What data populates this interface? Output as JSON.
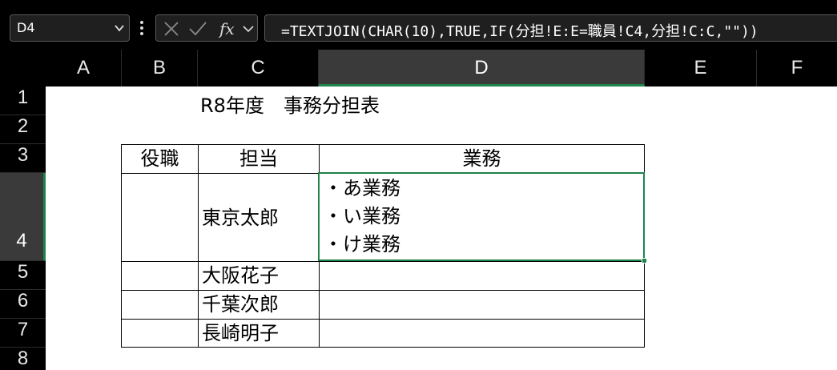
{
  "namebox": {
    "value": "D4"
  },
  "formula_bar": {
    "formula": "=TEXTJOIN(CHAR(10),TRUE,IF(分担!E:E=職員!C4,分担!C:C,\"\"))"
  },
  "columns": [
    {
      "id": "A",
      "label": "A"
    },
    {
      "id": "B",
      "label": "B"
    },
    {
      "id": "C",
      "label": "C"
    },
    {
      "id": "D",
      "label": "D"
    },
    {
      "id": "E",
      "label": "E"
    },
    {
      "id": "F",
      "label": "F"
    }
  ],
  "rows": [
    "1",
    "2",
    "3",
    "4",
    "5",
    "6",
    "7",
    "8"
  ],
  "sheet": {
    "title": "R8年度　事務分担表",
    "table": {
      "headers": {
        "role": "役職",
        "person": "担当",
        "tasks": "業務"
      },
      "row4": {
        "person": "東京太郎",
        "tasks": [
          "・あ業務",
          "・い業務",
          "・け業務"
        ]
      },
      "row5": {
        "person": "大阪花子"
      },
      "row6": {
        "person": "千葉次郎"
      },
      "row7": {
        "person": "長崎明子"
      }
    }
  },
  "colors": {
    "selection": "#1e8449",
    "header_selected": "#3a3a3a"
  }
}
